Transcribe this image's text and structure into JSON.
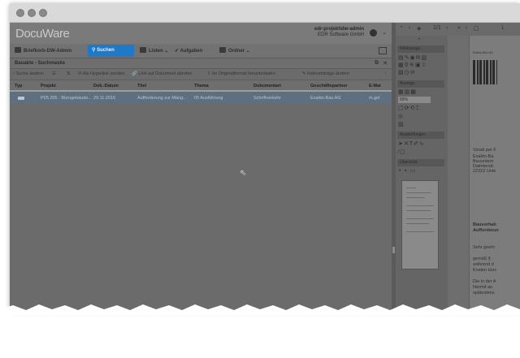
{
  "app": {
    "logo": "DocuWare",
    "user_name": "edr-projekt\\dw-admin",
    "user_company": "EDR Software GmbH"
  },
  "toolbar": {
    "briefkorb": "Briefkorb-DW-Admin",
    "suchen": "Suchen",
    "listen": "Listen",
    "aufgaben": "Aufgaben",
    "ordner": "Ordner"
  },
  "subhead": {
    "title": "Bauakte - Suchmaske"
  },
  "actions": {
    "edit_search": "Suche ändern",
    "hyperlink": "Als Hyperlink senden",
    "link_doc": "Link auf Dokument abrufen",
    "download_original": "Im Originalformat herunterladen",
    "index_edit": "Indexeinträge ändern"
  },
  "table": {
    "columns": [
      "Typ",
      "Projekt",
      "Dok.-Datum",
      "Titel",
      "Thema",
      "Dokumentart",
      "Geschäftspartner",
      "E-Mai"
    ],
    "row": [
      "P05.205 - Bürogebäude...",
      "29.11.2016",
      "Aufforderung zur Mäng...",
      "05 Ausführung",
      "Schriftverkehr",
      "Exakto-Bau AG",
      "m.gol"
    ]
  },
  "viewer": {
    "page_indicator": "1/1",
    "page_input": "1",
    "panels": {
      "werkzeuge": "Werkzeuge",
      "anzeige": "Anzeige",
      "zoom": "93%",
      "auswerfungen": "Auswerfungen",
      "uebersicht": "Übersicht"
    },
    "document": {
      "header_small": "Exakto-BAU AG",
      "vorab": "Vorab per F",
      "addr1": "Exakto-Ba",
      "addr2": "Bauuntern",
      "addr3": "Daimlerstr.",
      "addr4": "22222 Unte",
      "subject1": "Bauvorhab",
      "subject2": "Aufforderun",
      "greet": "Sehr geehr",
      "p1a": "gemäß § ·",
      "p1b": "während d",
      "p1c": "Kosten durc",
      "p2a": "Die in der A",
      "p2b": "hiermit au",
      "p2c": "spätestens"
    }
  }
}
